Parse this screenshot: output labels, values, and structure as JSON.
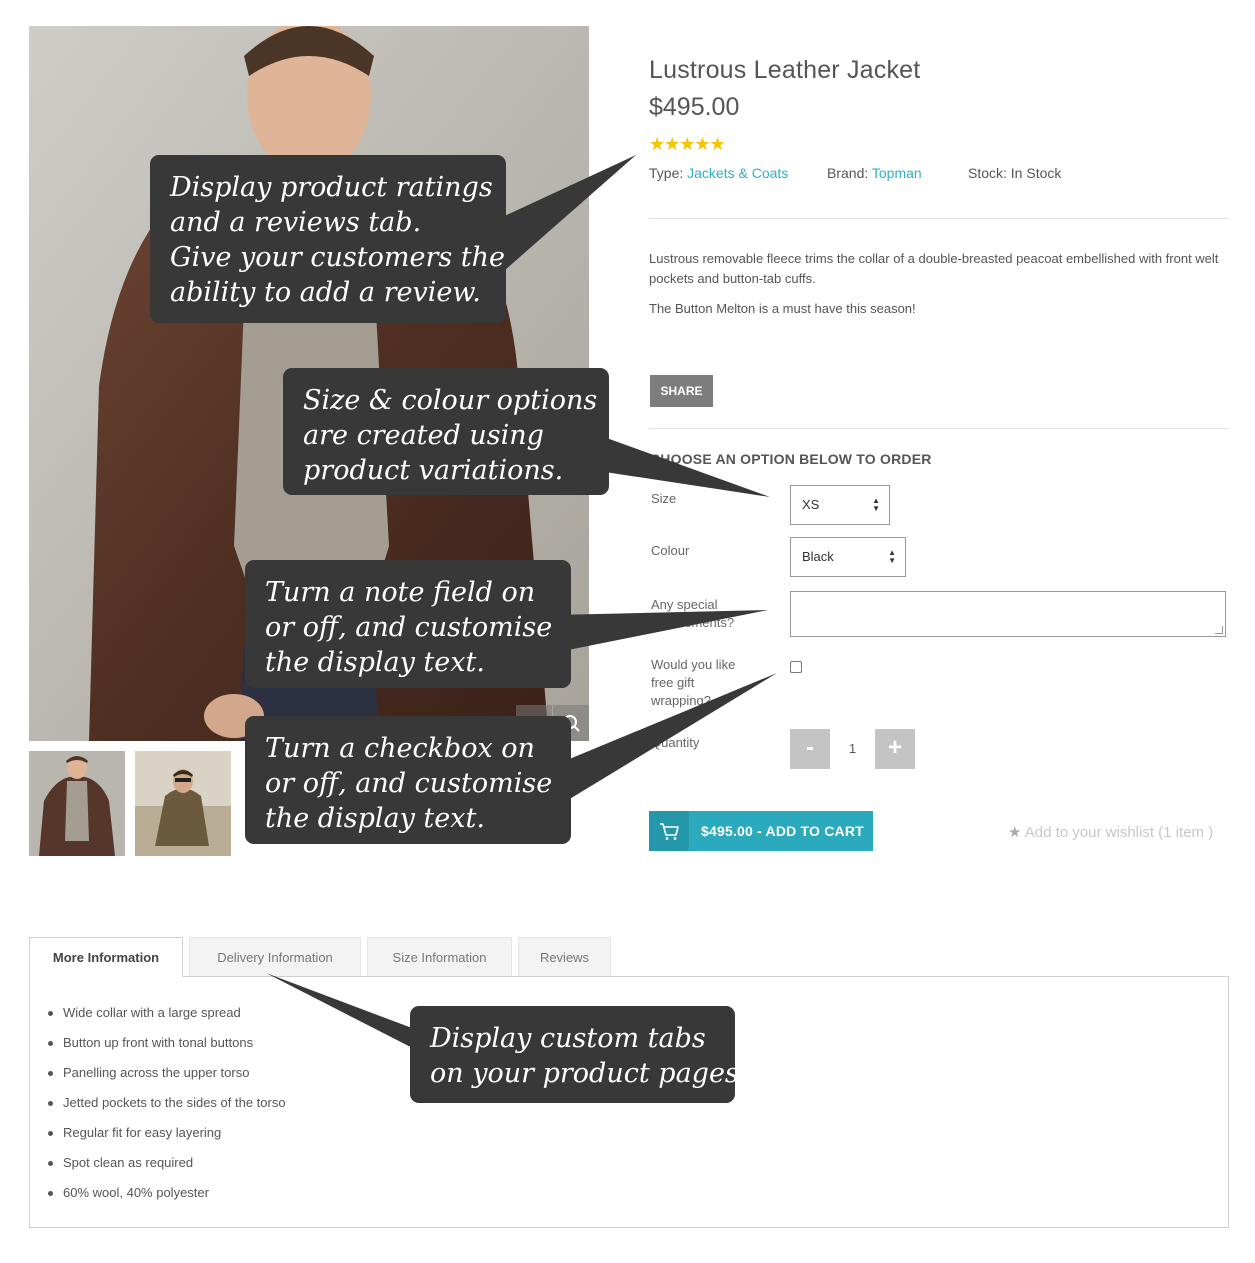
{
  "product": {
    "title": "Lustrous Leather Jacket",
    "price": "$495.00",
    "rating_stars": "★★★★★",
    "type_label": "Type:",
    "type_value": "Jackets & Coats",
    "brand_label": "Brand:",
    "brand_value": "Topman",
    "stock_text": "Stock: In Stock",
    "description_1": "Lustrous removable fleece trims the collar of a double-breasted peacoat embellished with front welt pockets and button-tab cuffs.",
    "description_2": "The Button Melton is a must have this season!"
  },
  "share_label": "SHARE",
  "options": {
    "heading": "CHOOSE AN OPTION BELOW TO ORDER",
    "size_label": "Size",
    "size_value": "XS",
    "colour_label": "Colour",
    "colour_value": "Black",
    "note_label": "Any special requirements?",
    "gift_label": "Would you like free gift wrapping?",
    "quantity_label": "Quantity",
    "quantity_value": "1",
    "minus": "-",
    "plus": "+"
  },
  "cart": {
    "add_label": "$495.00 - ADD TO CART",
    "wishlist_star": "★",
    "wishlist_text": "Add to your wishlist (1 item )"
  },
  "tabs": [
    {
      "label": "More Information"
    },
    {
      "label": "Delivery Information"
    },
    {
      "label": "Size Information"
    },
    {
      "label": "Reviews"
    }
  ],
  "more_info_items": [
    "Wide collar with a large spread",
    "Button up front with tonal buttons",
    "Panelling across the upper torso",
    "Jetted pockets to the sides of the torso",
    "Regular fit for easy layering",
    "Spot clean as required",
    "60% wool, 40% polyester"
  ],
  "callouts": {
    "ratings": [
      "Display product ratings",
      "and a reviews tab.",
      "Give your customers the",
      "ability to add a review."
    ],
    "variations": [
      "Size & colour options",
      "are created using",
      "product variations."
    ],
    "note": [
      "Turn a note field on",
      "or off, and customise",
      "the display text."
    ],
    "checkbox": [
      "Turn a checkbox on",
      "or off, and customise",
      "the display text."
    ],
    "tabs": [
      "Display custom tabs",
      "on your product pages"
    ]
  },
  "colors": {
    "accent": "#2ba9bd",
    "link": "#2fb0c2",
    "star": "#f5c400",
    "callout_bg": "#383838"
  }
}
